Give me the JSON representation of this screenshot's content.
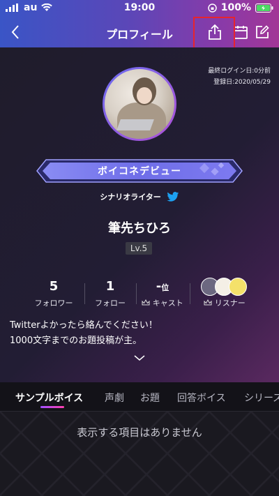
{
  "status_bar": {
    "carrier": "au",
    "time": "19:00",
    "battery": "100%"
  },
  "nav": {
    "title": "プロフィール"
  },
  "profile": {
    "last_login": "最終ログイン日:0分前",
    "registered": "登録日:2020/05/29",
    "badge": "ボイコネデビュー",
    "role": "シナリオライター",
    "name": "筆先ちひろ",
    "level": "Lv.5"
  },
  "stats": [
    {
      "value": "5",
      "label": "フォロワー"
    },
    {
      "value": "1",
      "label": "フォロー"
    },
    {
      "value": "-",
      "unit": "位",
      "label": "キャスト"
    },
    {
      "value": "",
      "label": "リスナー"
    }
  ],
  "bio": [
    "Twitterよかったら絡んでください！",
    "1000文字までのお題投稿が主。"
  ],
  "tabs": [
    "サンプルボイス",
    "声劇",
    "お題",
    "回答ボイス",
    "シリーズ"
  ],
  "empty_message": "表示する項目はありません",
  "colors": {
    "accent_pink": "#ff3fb0",
    "twitter_blue": "#1da1f2",
    "highlight_red": "#e8242d"
  }
}
